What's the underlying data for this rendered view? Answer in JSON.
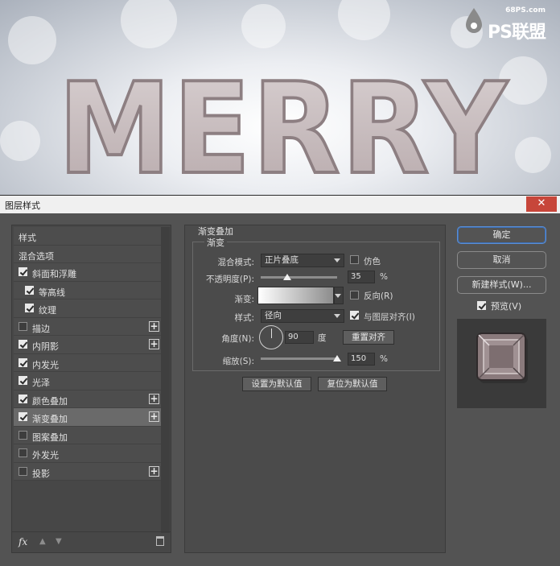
{
  "artwork": {
    "text": "MERRY",
    "watermark_site": "68PS.com",
    "watermark_logo": "PS联盟"
  },
  "dialog": {
    "title": "图层样式",
    "close_label": "✕"
  },
  "styles_list": {
    "items": [
      {
        "label": "样式",
        "checkbox": false,
        "checked": false,
        "plus": false,
        "indent": false,
        "selected": false
      },
      {
        "label": "混合选项",
        "checkbox": false,
        "checked": false,
        "plus": false,
        "indent": false,
        "selected": false
      },
      {
        "label": "斜面和浮雕",
        "checkbox": true,
        "checked": true,
        "plus": false,
        "indent": false,
        "selected": false
      },
      {
        "label": "等高线",
        "checkbox": true,
        "checked": true,
        "plus": false,
        "indent": true,
        "selected": false
      },
      {
        "label": "纹理",
        "checkbox": true,
        "checked": true,
        "plus": false,
        "indent": true,
        "selected": false
      },
      {
        "label": "描边",
        "checkbox": true,
        "checked": false,
        "plus": true,
        "indent": false,
        "selected": false
      },
      {
        "label": "内阴影",
        "checkbox": true,
        "checked": true,
        "plus": true,
        "indent": false,
        "selected": false
      },
      {
        "label": "内发光",
        "checkbox": true,
        "checked": true,
        "plus": false,
        "indent": false,
        "selected": false
      },
      {
        "label": "光泽",
        "checkbox": true,
        "checked": true,
        "plus": false,
        "indent": false,
        "selected": false
      },
      {
        "label": "颜色叠加",
        "checkbox": true,
        "checked": true,
        "plus": true,
        "indent": false,
        "selected": false
      },
      {
        "label": "渐变叠加",
        "checkbox": true,
        "checked": true,
        "plus": true,
        "indent": false,
        "selected": true
      },
      {
        "label": "图案叠加",
        "checkbox": true,
        "checked": false,
        "plus": false,
        "indent": false,
        "selected": false
      },
      {
        "label": "外发光",
        "checkbox": true,
        "checked": false,
        "plus": false,
        "indent": false,
        "selected": false
      },
      {
        "label": "投影",
        "checkbox": true,
        "checked": false,
        "plus": true,
        "indent": false,
        "selected": false
      }
    ],
    "footer": {
      "fx_label": "fx",
      "up_icon": "▲",
      "down_icon": "▼"
    }
  },
  "gradient_overlay": {
    "section_title": "渐变叠加",
    "group_title": "渐变",
    "blend_mode_label": "混合模式:",
    "blend_mode_value": "正片叠底",
    "dither_label": "仿色",
    "dither_checked": false,
    "opacity_label": "不透明度(P):",
    "opacity_value": "35",
    "opacity_fraction": 0.35,
    "opacity_unit": "%",
    "gradient_label": "渐变:",
    "reverse_label": "反向(R)",
    "reverse_checked": false,
    "style_label": "样式:",
    "style_value": "径向",
    "align_label": "与图层对齐(I)",
    "align_checked": true,
    "angle_label": "角度(N):",
    "angle_value": "90",
    "angle_unit": "度",
    "reset_align_label": "重置对齐",
    "scale_label": "缩放(S):",
    "scale_value": "150",
    "scale_fraction": 1.0,
    "scale_unit": "%",
    "set_default_label": "设置为默认值",
    "reset_default_label": "复位为默认值"
  },
  "right_panel": {
    "ok_label": "确定",
    "cancel_label": "取消",
    "new_style_label": "新建样式(W)...",
    "preview_label": "预览(V)",
    "preview_checked": true
  },
  "colors": {
    "dialog_bg": "#535353",
    "accent": "#5a8fd6",
    "close": "#c7463a"
  }
}
